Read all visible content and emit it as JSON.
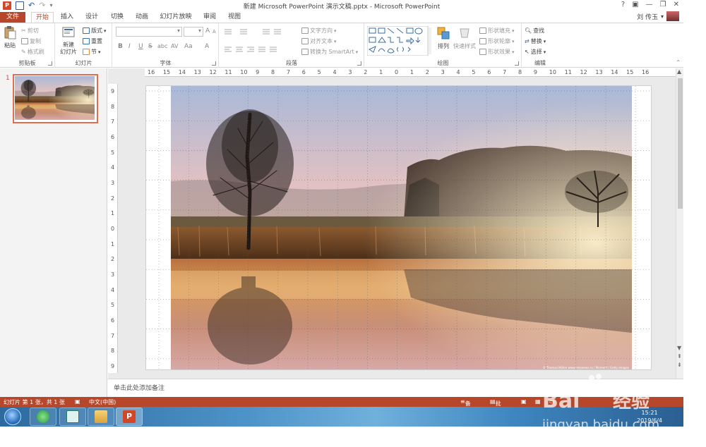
{
  "window": {
    "title": "新建 Microsoft PowerPoint 演示文稿.pptx - Microsoft PowerPoint",
    "controls": [
      "?",
      "▣",
      "—",
      "❐",
      "✕"
    ]
  },
  "tabs": [
    "文件",
    "开始",
    "插入",
    "设计",
    "切换",
    "动画",
    "幻灯片放映",
    "审阅",
    "视图"
  ],
  "active_tab": "开始",
  "user": {
    "name": "刘 传玉"
  },
  "ribbon": {
    "clipboard": {
      "label": "剪贴板",
      "paste": "粘贴",
      "cut": "剪切",
      "copy": "复制",
      "format_painter": "格式刷"
    },
    "slides": {
      "label": "幻灯片",
      "new_slide": "新建\n幻灯片",
      "layout": "版式",
      "reset": "重置",
      "section": "节"
    },
    "font": {
      "label": "字体",
      "bold": "B",
      "italic": "I",
      "underline": "U",
      "strike": "S",
      "shadow": "abc",
      "spacing": "AV",
      "case": "Aa",
      "color": "A",
      "grow": "A",
      "shrink": "A"
    },
    "paragraph": {
      "label": "段落",
      "text_direction": "文字方向",
      "align_text": "对齐文本",
      "smartart": "转换为 SmartArt"
    },
    "drawing": {
      "label": "绘图",
      "arrange": "排列",
      "quick_styles": "快速样式",
      "shape_fill": "形状填充",
      "shape_outline": "形状轮廓",
      "shape_effects": "形状效果"
    },
    "editing": {
      "label": "编辑",
      "find": "查找",
      "replace": "替换",
      "select": "选择"
    }
  },
  "ruler": {
    "horizontal": [
      "16",
      "15",
      "14",
      "13",
      "12",
      "11",
      "10",
      "9",
      "8",
      "7",
      "6",
      "5",
      "4",
      "3",
      "2",
      "1",
      "0",
      "1",
      "2",
      "3",
      "4",
      "5",
      "6",
      "7",
      "8",
      "9",
      "10",
      "11",
      "12",
      "13",
      "14",
      "15",
      "16"
    ],
    "vertical": [
      "9",
      "8",
      "7",
      "6",
      "5",
      "4",
      "3",
      "2",
      "1",
      "0",
      "1",
      "2",
      "3",
      "4",
      "5",
      "6",
      "7",
      "8",
      "9"
    ]
  },
  "thumbnail": {
    "number": "1"
  },
  "slide": {
    "photo_credit": "© Thomas Müller www.retsweies.ru / Moment / Getty Images"
  },
  "notes": {
    "placeholder": "单击此处添加备注"
  },
  "status": {
    "slide_info": "幻灯片 第 1 张，共 1 张",
    "language": "中文(中国)",
    "notes_btn": "备注",
    "comments_btn": "批注"
  },
  "taskbar": {
    "time": "15:21",
    "date": "2019/6/4"
  },
  "colors": {
    "accent": "#b7472a",
    "thumb_border": "#e06e4f"
  }
}
